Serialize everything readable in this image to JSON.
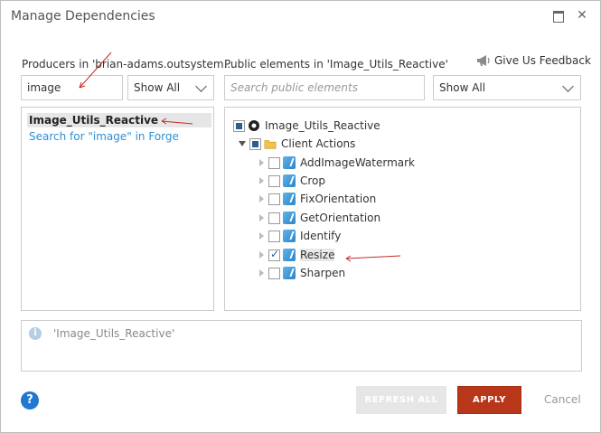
{
  "window": {
    "title": "Manage Dependencies"
  },
  "producers": {
    "label": "Producers in 'brian-adams.outsystem...",
    "search_value": "image",
    "filter_value": "Show All",
    "items": [
      {
        "label": "Image_Utils_Reactive"
      },
      {
        "label": "Search for \"image\" in Forge"
      }
    ]
  },
  "public_elements": {
    "label": "Public elements in 'Image_Utils_Reactive'",
    "search_placeholder": "Search public elements",
    "filter_value": "Show All",
    "tree": {
      "root": "Image_Utils_Reactive",
      "group": "Client Actions",
      "actions": [
        {
          "label": "AddImageWatermark",
          "checked": false
        },
        {
          "label": "Crop",
          "checked": false
        },
        {
          "label": "FixOrientation",
          "checked": false
        },
        {
          "label": "GetOrientation",
          "checked": false
        },
        {
          "label": "Identify",
          "checked": false
        },
        {
          "label": "Resize",
          "checked": true
        },
        {
          "label": "Sharpen",
          "checked": false
        }
      ]
    }
  },
  "feedback": {
    "label": "Give Us Feedback"
  },
  "info": {
    "text": "'Image_Utils_Reactive'"
  },
  "footer": {
    "help_label": "?",
    "refresh_label": "REFRESH ALL",
    "apply_label": "APPLY",
    "cancel_label": "Cancel"
  },
  "colors": {
    "apply": "#b8361a",
    "link": "#2f8fd6",
    "help": "#1f78d1",
    "annotation_arrow": "#c62828"
  }
}
